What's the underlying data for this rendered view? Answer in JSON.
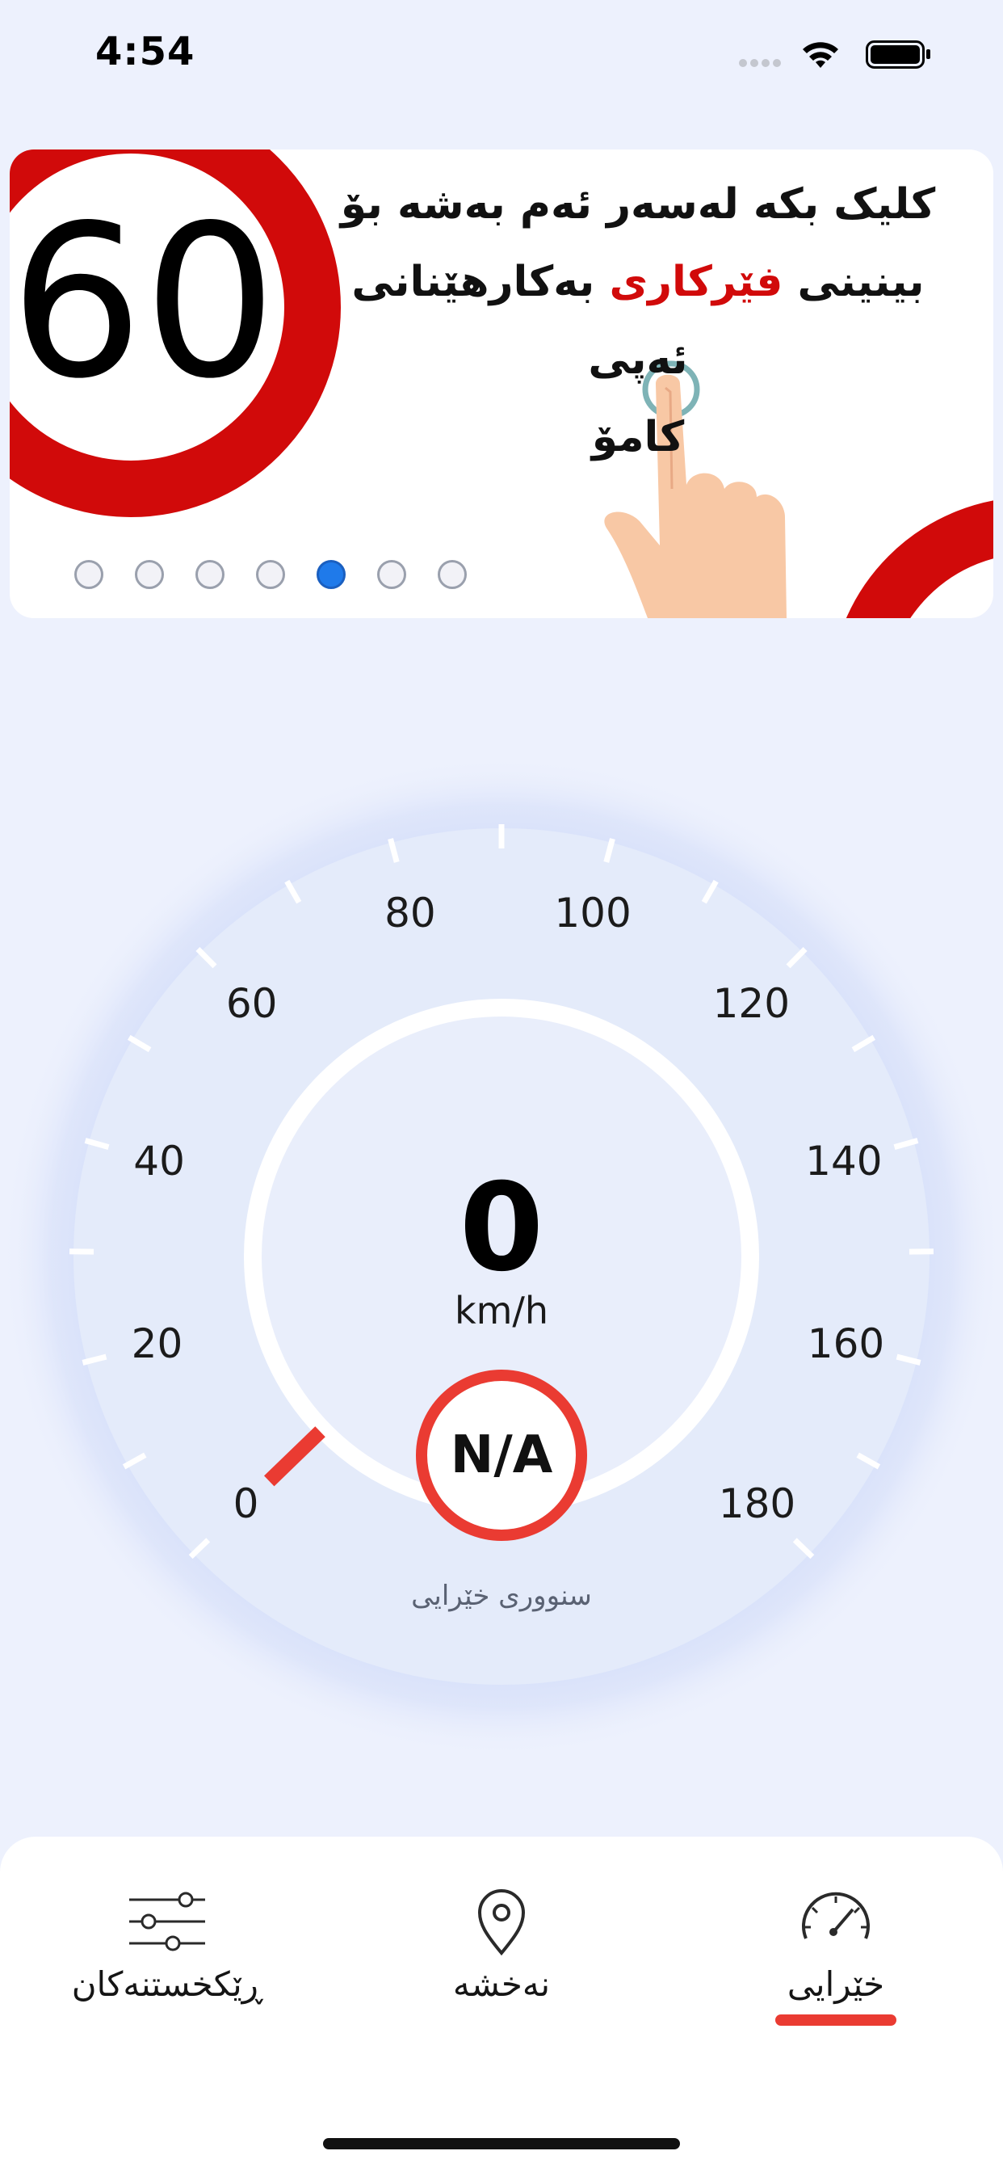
{
  "status_bar": {
    "time": "4:54",
    "icons": [
      "signal-icon",
      "wifi-icon",
      "battery-icon"
    ]
  },
  "banner": {
    "sign_number": "60",
    "text_line1": "کلیک بکە لەسەر ئەم بەشە بۆ",
    "text_line2_before": "بینینی ",
    "text_line2_highlight": "فێرکاری",
    "text_line2_after": " بەکارهێنانی ئەپی",
    "text_line3": "کامۆ",
    "page_count": 7,
    "active_page": 5,
    "colors": {
      "sign_red": "#d10a0a",
      "highlight": "#d10a0a",
      "dot_active": "#1f7aea"
    }
  },
  "speedometer": {
    "speed": "0",
    "unit": "km/h",
    "speed_limit": "N/A",
    "speed_limit_label": "سنووری خێرایی",
    "scale_labels": [
      "0",
      "20",
      "40",
      "60",
      "80",
      "100",
      "120",
      "140",
      "160",
      "180"
    ],
    "needle_value": 0,
    "colors": {
      "needle": "#ea3b32",
      "limit_ring": "#ea3b32"
    }
  },
  "tab_bar": {
    "tabs": [
      {
        "label": "ڕێکخستنەکان",
        "icon": "sliders-icon"
      },
      {
        "label": "نەخشە",
        "icon": "map-pin-icon"
      },
      {
        "label": "خێرایی",
        "icon": "speedometer-icon"
      }
    ],
    "selected": "خێرایی",
    "accent": "#ea3b32"
  }
}
